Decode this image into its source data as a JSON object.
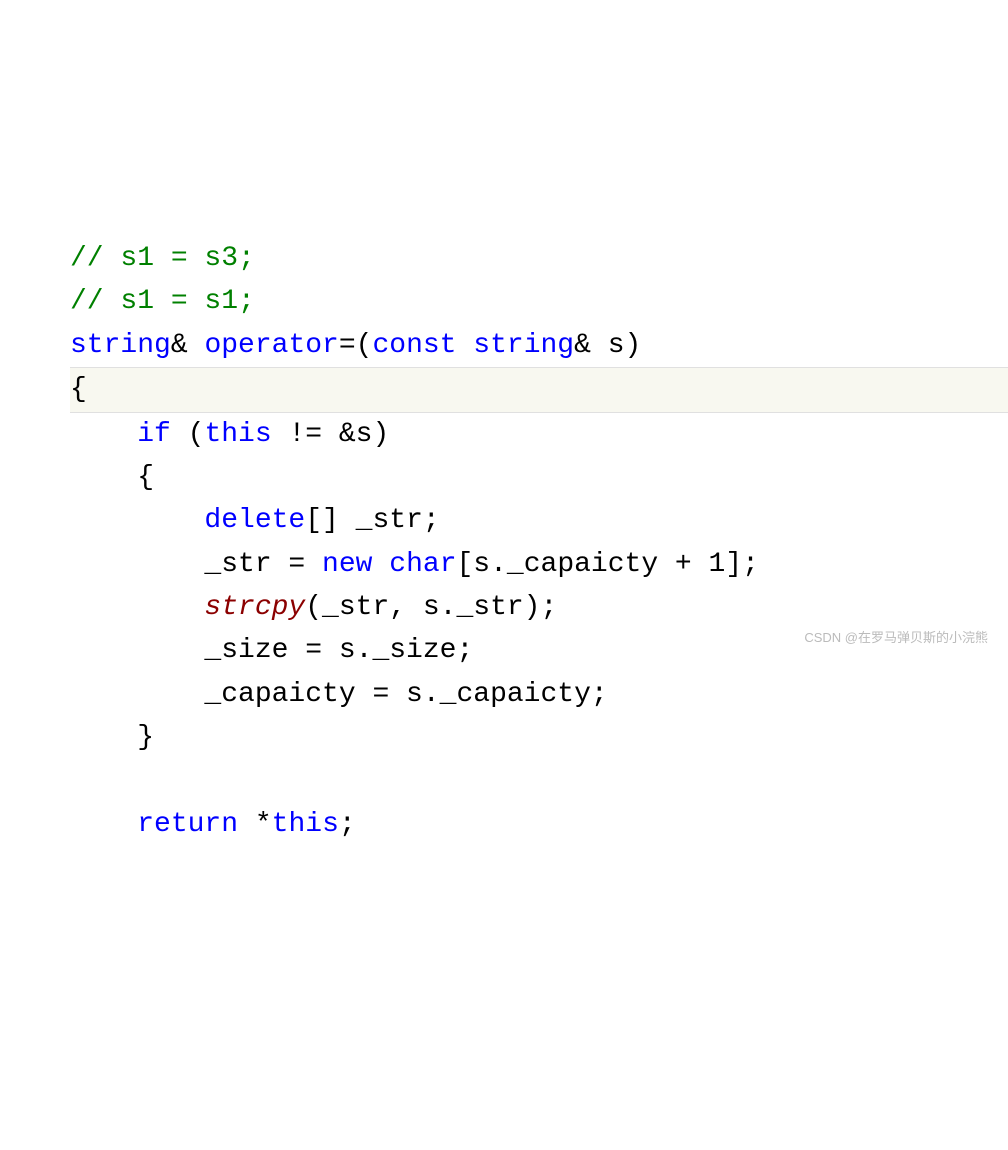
{
  "code": {
    "line1_comment": "// s1 = s3;",
    "line2_comment": "// s1 = s1;",
    "line3_type1": "string",
    "line3_amp1": "& ",
    "line3_keyword": "operator",
    "line3_mid": "=(",
    "line3_const": "const",
    "line3_sp": " ",
    "line3_type2": "string",
    "line3_end": "& s)",
    "line4": "{",
    "line5_indent": "    ",
    "line5_if": "if",
    "line5_open": " (",
    "line5_this": "this",
    "line5_rest": " != &s)",
    "line6": "    {",
    "line7_indent": "        ",
    "line7_delete": "delete",
    "line7_rest": "[] _str;",
    "line8_indent": "        _str = ",
    "line8_new": "new",
    "line8_sp": " ",
    "line8_char": "char",
    "line8_rest": "[s._capaicty + 1];",
    "line9_indent": "        ",
    "line9_func": "strcpy",
    "line9_rest": "(_str, s._str);",
    "line10": "        _size = s._size;",
    "line11": "        _capaicty = s._capaicty;",
    "line12": "    }",
    "line13_indent": "    ",
    "line13_return": "return",
    "line13_sp": " *",
    "line13_this": "this",
    "line13_rest": ";"
  },
  "watermark": "CSDN @在罗马弹贝斯的小浣熊"
}
